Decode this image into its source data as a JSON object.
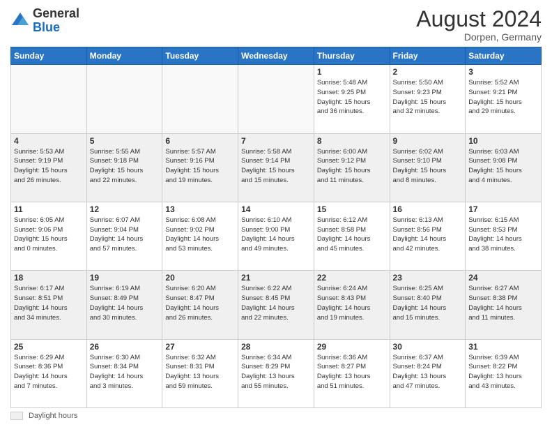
{
  "header": {
    "logo_general": "General",
    "logo_blue": "Blue",
    "month_title": "August 2024",
    "subtitle": "Dorpen, Germany"
  },
  "footer": {
    "legend_label": "Daylight hours"
  },
  "calendar": {
    "days_of_week": [
      "Sunday",
      "Monday",
      "Tuesday",
      "Wednesday",
      "Thursday",
      "Friday",
      "Saturday"
    ],
    "weeks": [
      [
        {
          "day": "",
          "info": "",
          "empty": true
        },
        {
          "day": "",
          "info": "",
          "empty": true
        },
        {
          "day": "",
          "info": "",
          "empty": true
        },
        {
          "day": "",
          "info": "",
          "empty": true
        },
        {
          "day": "1",
          "info": "Sunrise: 5:48 AM\nSunset: 9:25 PM\nDaylight: 15 hours\nand 36 minutes."
        },
        {
          "day": "2",
          "info": "Sunrise: 5:50 AM\nSunset: 9:23 PM\nDaylight: 15 hours\nand 32 minutes."
        },
        {
          "day": "3",
          "info": "Sunrise: 5:52 AM\nSunset: 9:21 PM\nDaylight: 15 hours\nand 29 minutes."
        }
      ],
      [
        {
          "day": "4",
          "info": "Sunrise: 5:53 AM\nSunset: 9:19 PM\nDaylight: 15 hours\nand 26 minutes."
        },
        {
          "day": "5",
          "info": "Sunrise: 5:55 AM\nSunset: 9:18 PM\nDaylight: 15 hours\nand 22 minutes."
        },
        {
          "day": "6",
          "info": "Sunrise: 5:57 AM\nSunset: 9:16 PM\nDaylight: 15 hours\nand 19 minutes."
        },
        {
          "day": "7",
          "info": "Sunrise: 5:58 AM\nSunset: 9:14 PM\nDaylight: 15 hours\nand 15 minutes."
        },
        {
          "day": "8",
          "info": "Sunrise: 6:00 AM\nSunset: 9:12 PM\nDaylight: 15 hours\nand 11 minutes."
        },
        {
          "day": "9",
          "info": "Sunrise: 6:02 AM\nSunset: 9:10 PM\nDaylight: 15 hours\nand 8 minutes."
        },
        {
          "day": "10",
          "info": "Sunrise: 6:03 AM\nSunset: 9:08 PM\nDaylight: 15 hours\nand 4 minutes."
        }
      ],
      [
        {
          "day": "11",
          "info": "Sunrise: 6:05 AM\nSunset: 9:06 PM\nDaylight: 15 hours\nand 0 minutes."
        },
        {
          "day": "12",
          "info": "Sunrise: 6:07 AM\nSunset: 9:04 PM\nDaylight: 14 hours\nand 57 minutes."
        },
        {
          "day": "13",
          "info": "Sunrise: 6:08 AM\nSunset: 9:02 PM\nDaylight: 14 hours\nand 53 minutes."
        },
        {
          "day": "14",
          "info": "Sunrise: 6:10 AM\nSunset: 9:00 PM\nDaylight: 14 hours\nand 49 minutes."
        },
        {
          "day": "15",
          "info": "Sunrise: 6:12 AM\nSunset: 8:58 PM\nDaylight: 14 hours\nand 45 minutes."
        },
        {
          "day": "16",
          "info": "Sunrise: 6:13 AM\nSunset: 8:56 PM\nDaylight: 14 hours\nand 42 minutes."
        },
        {
          "day": "17",
          "info": "Sunrise: 6:15 AM\nSunset: 8:53 PM\nDaylight: 14 hours\nand 38 minutes."
        }
      ],
      [
        {
          "day": "18",
          "info": "Sunrise: 6:17 AM\nSunset: 8:51 PM\nDaylight: 14 hours\nand 34 minutes."
        },
        {
          "day": "19",
          "info": "Sunrise: 6:19 AM\nSunset: 8:49 PM\nDaylight: 14 hours\nand 30 minutes."
        },
        {
          "day": "20",
          "info": "Sunrise: 6:20 AM\nSunset: 8:47 PM\nDaylight: 14 hours\nand 26 minutes."
        },
        {
          "day": "21",
          "info": "Sunrise: 6:22 AM\nSunset: 8:45 PM\nDaylight: 14 hours\nand 22 minutes."
        },
        {
          "day": "22",
          "info": "Sunrise: 6:24 AM\nSunset: 8:43 PM\nDaylight: 14 hours\nand 19 minutes."
        },
        {
          "day": "23",
          "info": "Sunrise: 6:25 AM\nSunset: 8:40 PM\nDaylight: 14 hours\nand 15 minutes."
        },
        {
          "day": "24",
          "info": "Sunrise: 6:27 AM\nSunset: 8:38 PM\nDaylight: 14 hours\nand 11 minutes."
        }
      ],
      [
        {
          "day": "25",
          "info": "Sunrise: 6:29 AM\nSunset: 8:36 PM\nDaylight: 14 hours\nand 7 minutes."
        },
        {
          "day": "26",
          "info": "Sunrise: 6:30 AM\nSunset: 8:34 PM\nDaylight: 14 hours\nand 3 minutes."
        },
        {
          "day": "27",
          "info": "Sunrise: 6:32 AM\nSunset: 8:31 PM\nDaylight: 13 hours\nand 59 minutes."
        },
        {
          "day": "28",
          "info": "Sunrise: 6:34 AM\nSunset: 8:29 PM\nDaylight: 13 hours\nand 55 minutes."
        },
        {
          "day": "29",
          "info": "Sunrise: 6:36 AM\nSunset: 8:27 PM\nDaylight: 13 hours\nand 51 minutes."
        },
        {
          "day": "30",
          "info": "Sunrise: 6:37 AM\nSunset: 8:24 PM\nDaylight: 13 hours\nand 47 minutes."
        },
        {
          "day": "31",
          "info": "Sunrise: 6:39 AM\nSunset: 8:22 PM\nDaylight: 13 hours\nand 43 minutes."
        }
      ]
    ]
  }
}
